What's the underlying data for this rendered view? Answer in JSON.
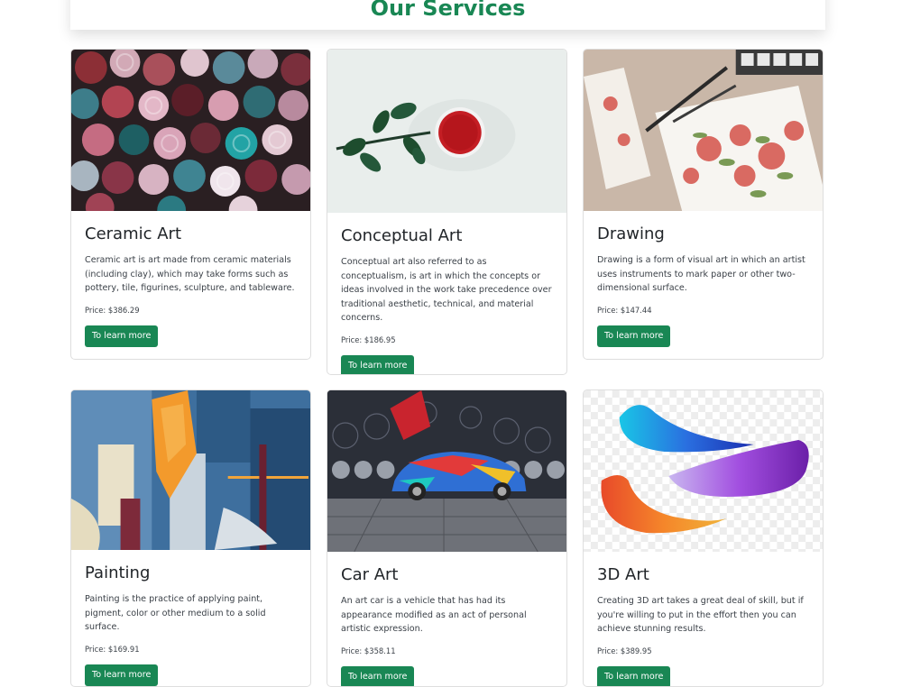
{
  "header": {
    "title": "Our Services"
  },
  "cards": [
    {
      "title": "Ceramic Art",
      "description": "Ceramic art is art made from ceramic materials (including clay), which may take forms such as pottery, tile, figurines, sculpture, and tableware.",
      "price": "Price: $386.29",
      "button": "To learn more"
    },
    {
      "title": "Conceptual Art",
      "description": "Conceptual art also referred to as conceptualism, is art in which the concepts or ideas involved in the work take precedence over traditional aesthetic, technical, and material concerns.",
      "price": "Price: $186.95",
      "button": "To learn more"
    },
    {
      "title": "Drawing",
      "description": "Drawing is a form of visual art in which an artist uses instruments to mark paper or other two-dimensional surface.",
      "price": "Price: $147.44",
      "button": "To learn more"
    },
    {
      "title": "Painting",
      "description": "Painting is the practice of applying paint, pigment, color or other medium to a solid surface.",
      "price": "Price: $169.91",
      "button": "To learn more"
    },
    {
      "title": "Car Art",
      "description": "An art car is a vehicle that has had its appearance modified as an act of personal artistic expression.",
      "price": "Price: $358.11",
      "button": "To learn more"
    },
    {
      "title": "3D Art",
      "description": "Creating 3D art takes a great deal of skill, but if you're willing to put in the effort then you can achieve stunning results.",
      "price": "Price: $389.95",
      "button": "To learn more"
    }
  ],
  "colors": {
    "accent": "#198754"
  }
}
